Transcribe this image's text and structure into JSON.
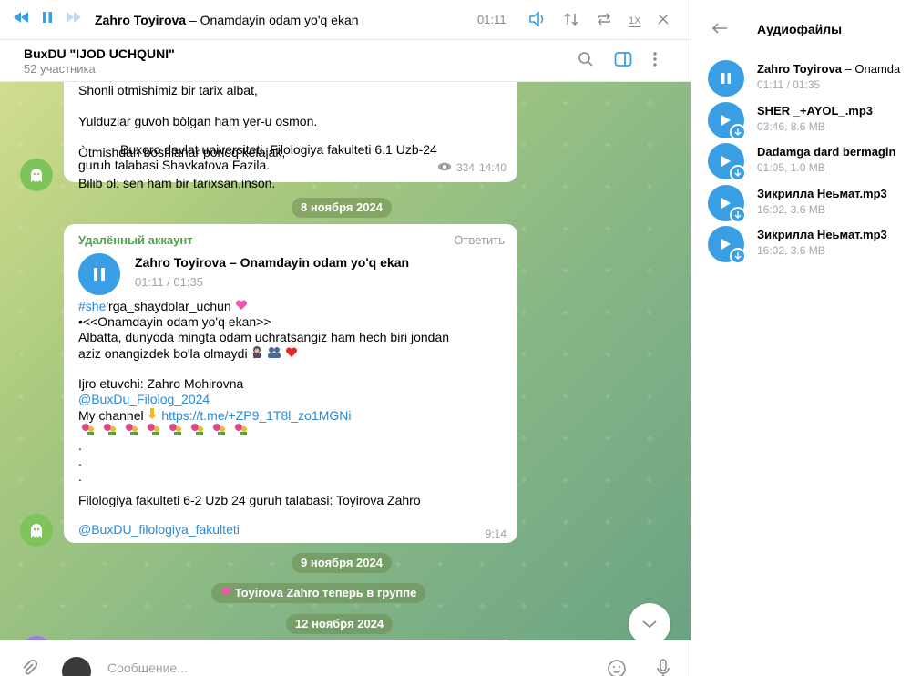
{
  "player": {
    "title_bold": "Zahro Toyirova",
    "title_rest": " – Onamdayin odam yo'q ekan",
    "time": "01:11",
    "speed": "1X"
  },
  "chat": {
    "title": "BuxDU \"IJOD UCHQUNI\"",
    "subtitle": "52 участника"
  },
  "messages": {
    "m1": {
      "lines": [
        "Shonli otmishimiz bir tarix albat,",
        "Yulduzlar guvoh bòlgan ham yer-u osmon.",
        "Òtmishdan boshlanar porloq kelajak,",
        "Bilib ol: sen ham bir tarixsan,inson."
      ],
      "sign_1": "Buxoro davlat universiteti. Filologiya fakulteti 6.1 Uzb-24",
      "sign_2": "guruh talabasi Shavkatova Fazila.",
      "views": "334",
      "time": "14:40"
    },
    "date_1": "8 ноября 2024",
    "m2": {
      "sender": "Удалённый аккаунт",
      "reply": "Ответить",
      "audio_title": "Zahro Toyirova – Onamdayin odam yo'q ekan",
      "audio_time": "01:11 / 01:35",
      "hashtag": "#she",
      "hashtag_rest": "'rga_shaydolar_uchun",
      "quote": "•<<Onamdayin odam yo'q ekan>>",
      "text_1": "Albatta, dunyoda mingta odam uchratsangiz ham hech biri jondan",
      "text_2": "aziz onangizdek bo'la olmaydi",
      "performer": "Ijro etuvchi: Zahro Mohirovna",
      "mention": "@BuxDu_Filolog_2024",
      "channel_label": "My channel",
      "channel_link": "https://t.me/+ZP9_1T8l_zo1MGNi",
      "dot": ".",
      "footer": "Filologiya fakulteti 6-2 Uzb 24 guruh talabasi: Toyirova Zahro",
      "footer_link": "@BuxDU_filologiya_fakulteti",
      "time": "9:14"
    },
    "date_2": "9 ноября 2024",
    "service": " Toyirova Zahro  теперь в группе",
    "date_3": "12 ноября 2024"
  },
  "composer": {
    "placeholder": "Сообщение..."
  },
  "panel": {
    "title": "Аудиофайлы",
    "tracks": [
      {
        "name": "Zahro Toyirova",
        "name_rest": " – Onamda",
        "meta": "01:11 / 01:35",
        "state": "playing"
      },
      {
        "name": "SHER _+AYOL_.mp3",
        "name_rest": "",
        "meta": "03:46, 8.6 MB",
        "state": "download"
      },
      {
        "name": "Dadamga dard bermagin",
        "name_rest": "",
        "meta": "01:05, 1.0 MB",
        "state": "download"
      },
      {
        "name": "Зикрилла Неьмат.mp3",
        "name_rest": "",
        "meta": "16:02, 3.6 MB",
        "state": "download"
      },
      {
        "name": "Зикрилла Неьмат.mp3",
        "name_rest": "",
        "meta": "16:02, 3.6 MB",
        "state": "download"
      }
    ]
  },
  "colors": {
    "accent": "#3a9ee4",
    "sender_green": "#4aa24a",
    "link_blue": "#2a8ad8"
  }
}
